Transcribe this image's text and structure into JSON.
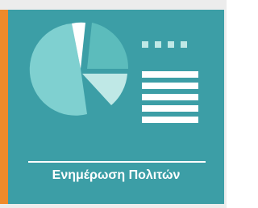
{
  "tile": {
    "caption": "Ενημέρωση Πολιτών",
    "icon": "pie-chart-report-icon"
  },
  "colors": {
    "card_background": "#3c9ea6",
    "accent": "#ef8a2a",
    "pie_light": "#7fd0d0",
    "pie_medium": "#5cbcbc",
    "pie_pale": "#bfe8e6",
    "text": "#ffffff"
  }
}
